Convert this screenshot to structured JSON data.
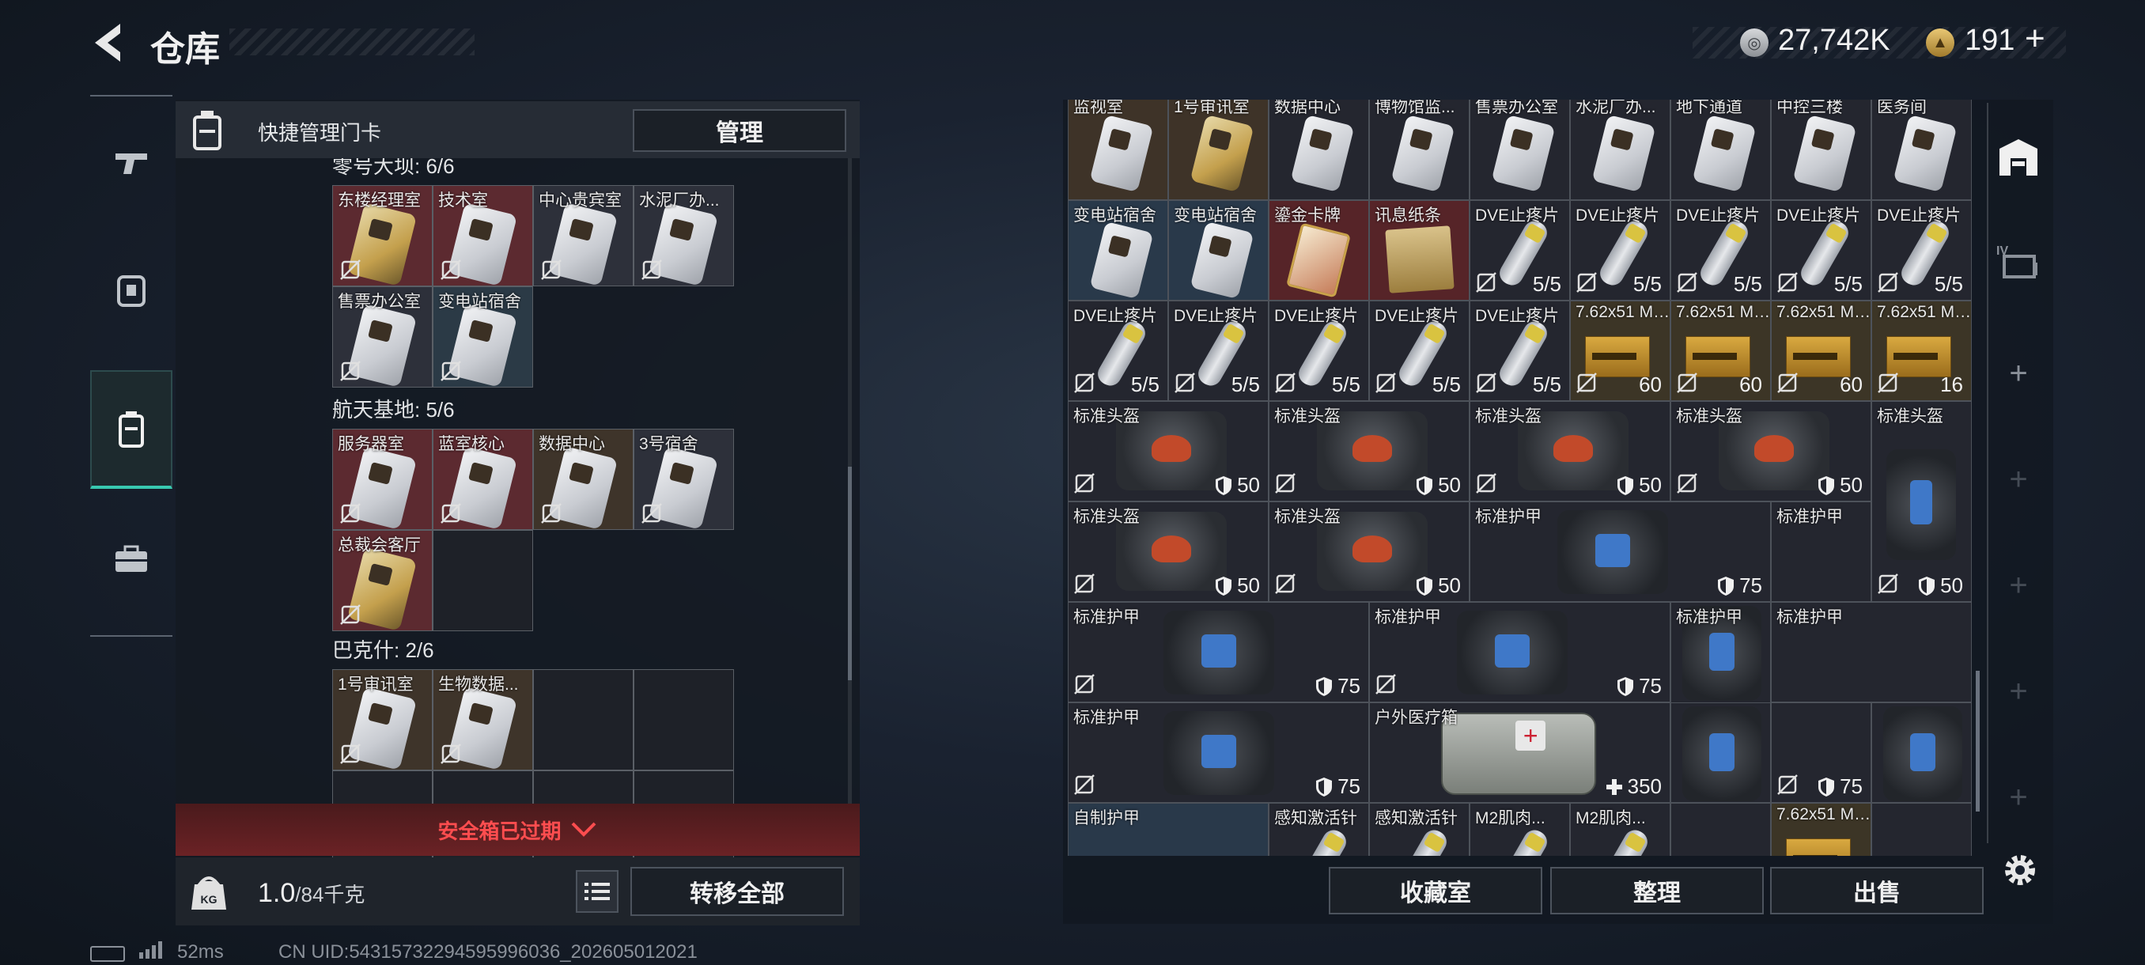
{
  "header": {
    "title": "仓库",
    "money": "27,742K",
    "bonds": "191",
    "plus": "+"
  },
  "side_nav": [
    "gun-icon",
    "armor-icon",
    "keycard-icon",
    "case-icon"
  ],
  "left_panel": {
    "header_label": "快捷管理门卡",
    "manage_button": "管理",
    "sections": [
      {
        "title": "零号大坝: 6/6",
        "cards": [
          {
            "name": "东楼经理室",
            "style": "gold",
            "bg": "red"
          },
          {
            "name": "技术室",
            "style": "white",
            "bg": "red"
          },
          {
            "name": "中心贵宾室",
            "style": "white",
            "bg": "grey"
          },
          {
            "name": "水泥厂办...",
            "style": "white",
            "bg": "grey"
          },
          {
            "name": "售票办公室",
            "style": "white",
            "bg": "grey"
          },
          {
            "name": "变电站宿舍",
            "style": "white",
            "bg": "blue"
          }
        ]
      },
      {
        "title": "航天基地: 5/6",
        "cards": [
          {
            "name": "服务器室",
            "style": "white",
            "bg": "red"
          },
          {
            "name": "蓝室核心",
            "style": "white",
            "bg": "red"
          },
          {
            "name": "数据中心",
            "style": "white",
            "bg": "brown"
          },
          {
            "name": "3号宿舍",
            "style": "white",
            "bg": "grey"
          },
          {
            "name": "总裁会客厅",
            "style": "gold",
            "bg": "red"
          }
        ]
      },
      {
        "title": "巴克什: 2/6",
        "cards": [
          {
            "name": "1号审讯室",
            "style": "white",
            "bg": "brown"
          },
          {
            "name": "生物数据...",
            "style": "white",
            "bg": "brown"
          }
        ]
      }
    ],
    "safe_expired": "安全箱已过期",
    "weight_value": "1.0",
    "weight_cap": "/84千克",
    "transfer_all": "转移全部"
  },
  "status": {
    "ping": "52ms",
    "uid": "CN UID:54315732294595996036_202605012021"
  },
  "right_panel": {
    "row1": [
      "监视室",
      "1号审讯室",
      "数据中心",
      "博物馆监...",
      "售票办公室",
      "水泥厂办...",
      "地下通道",
      "中控三楼",
      "医务间"
    ],
    "row2": [
      {
        "name": "变电站宿舍",
        "kind": "card"
      },
      {
        "name": "变电站宿舍",
        "kind": "card"
      },
      {
        "name": "鎏金卡牌",
        "kind": "goldcard"
      },
      {
        "name": "讯息纸条",
        "kind": "doc"
      },
      {
        "name": "DVE止疼片",
        "kind": "pill",
        "count": "5/5"
      },
      {
        "name": "DVE止疼片",
        "kind": "pill",
        "count": "5/5"
      },
      {
        "name": "DVE止疼片",
        "kind": "pill",
        "count": "5/5"
      },
      {
        "name": "DVE止疼片",
        "kind": "pill",
        "count": "5/5"
      },
      {
        "name": "DVE止疼片",
        "kind": "pill",
        "count": "5/5"
      }
    ],
    "row3": [
      {
        "name": "DVE止疼片",
        "kind": "pill",
        "count": "5/5"
      },
      {
        "name": "DVE止疼片",
        "kind": "pill",
        "count": "5/5"
      },
      {
        "name": "DVE止疼片",
        "kind": "pill",
        "count": "5/5"
      },
      {
        "name": "DVE止疼片",
        "kind": "pill",
        "count": "5/5"
      },
      {
        "name": "DVE止疼片",
        "kind": "pill",
        "count": "5/5"
      },
      {
        "name": "7.62x51 M80",
        "kind": "ammo",
        "count": "60"
      },
      {
        "name": "7.62x51 M80",
        "kind": "ammo",
        "count": "60"
      },
      {
        "name": "7.62x51 M80",
        "kind": "ammo",
        "count": "60"
      },
      {
        "name": "7.62x51 M80",
        "kind": "ammo",
        "count": "16"
      }
    ],
    "helmet_name": "标准头盔",
    "vest_name": "标准护甲",
    "medkit_name": "户外医疗箱",
    "self_armor": "自制护甲",
    "sense_syringe": "感知激活针",
    "m2_syringe": "M2肌肉...",
    "ammo_name": "7.62x51 M80",
    "counts": {
      "helmet": "50",
      "vest": "75",
      "medkit": "350"
    },
    "buttons": {
      "collection": "收藏室",
      "sort": "整理",
      "sell": "出售"
    }
  },
  "colors": {
    "accent_teal": "#38c9b0",
    "warning_red": "#ff4d4f",
    "card_red": "#5c2a30"
  }
}
